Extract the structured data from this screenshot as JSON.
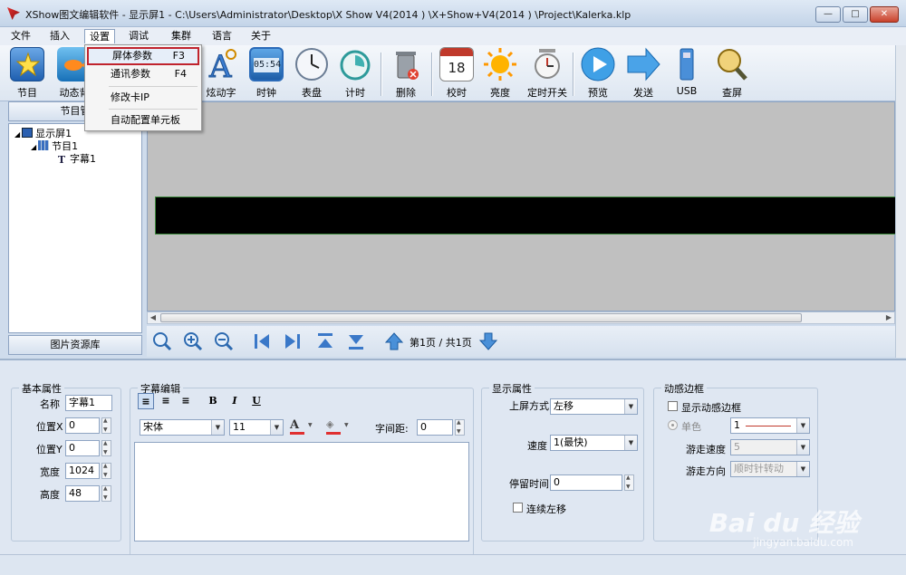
{
  "window": {
    "title": "XShow图文编辑软件 - 显示屏1 - C:\\Users\\Administrator\\Desktop\\X Show V4(2014 ) \\X+Show+V4(2014 ) \\Project\\Kalerka.klp"
  },
  "menubar": {
    "items": [
      "文件",
      "插入",
      "设置",
      "调试",
      "集群",
      "语言",
      "关于"
    ],
    "active": "设置"
  },
  "dropdown": {
    "items": [
      {
        "label": "屏体参数",
        "shortcut": "F3"
      },
      {
        "label": "通讯参数",
        "shortcut": "F4"
      },
      {
        "label": "修改卡IP",
        "shortcut": ""
      },
      {
        "label": "自动配置单元板",
        "shortcut": ""
      }
    ]
  },
  "toolbar": {
    "items": [
      "节目",
      "动态背",
      "炫动字",
      "时钟",
      "表盘",
      "计时",
      "删除",
      "校时",
      "亮度",
      "定时开关",
      "预览",
      "发送",
      "USB",
      "查屏"
    ],
    "clock_display": "05:54",
    "calendar_day": "18"
  },
  "left_panel": {
    "top_tab": "节目管",
    "bottom_tab": "图片资源库",
    "tree": [
      {
        "label": "显示屏1"
      },
      {
        "label": "节目1"
      },
      {
        "label": "字幕1"
      }
    ]
  },
  "canvas_toolbar": {
    "page_label": "第1页 / 共1页"
  },
  "props": {
    "basic": {
      "title": "基本属性",
      "name_label": "名称",
      "name_value": "字幕1",
      "x_label": "位置X",
      "x_value": "0",
      "y_label": "位置Y",
      "y_value": "0",
      "width_label": "宽度",
      "width_value": "1024",
      "height_label": "高度",
      "height_value": "48"
    },
    "subtitle": {
      "title": "字幕编辑",
      "font": "宋体",
      "size": "11",
      "spacing_label": "字间距:",
      "spacing_value": "0",
      "bold": "B",
      "italic": "I",
      "underline": "U"
    },
    "display": {
      "title": "显示属性",
      "mode_label": "上屏方式",
      "mode_value": "左移",
      "speed_label": "速度",
      "speed_value": "1(最快)",
      "stay_label": "停留时间",
      "stay_value": "0",
      "continuous_label": "连续左移"
    },
    "border": {
      "title": "动感边框",
      "show_label": "显示动感边框",
      "mono_label": "单色",
      "mono_value": "1",
      "speed_label": "游走速度",
      "speed_value": "5",
      "dir_label": "游走方向",
      "dir_value": "顺时针转动"
    }
  },
  "watermark": {
    "main": "Bai du 经验",
    "sub": "jingyan.baidu.com"
  },
  "colors": {
    "accent": "#c0232d",
    "canvas_bg": "#c0c0c0",
    "led": "#000000"
  }
}
